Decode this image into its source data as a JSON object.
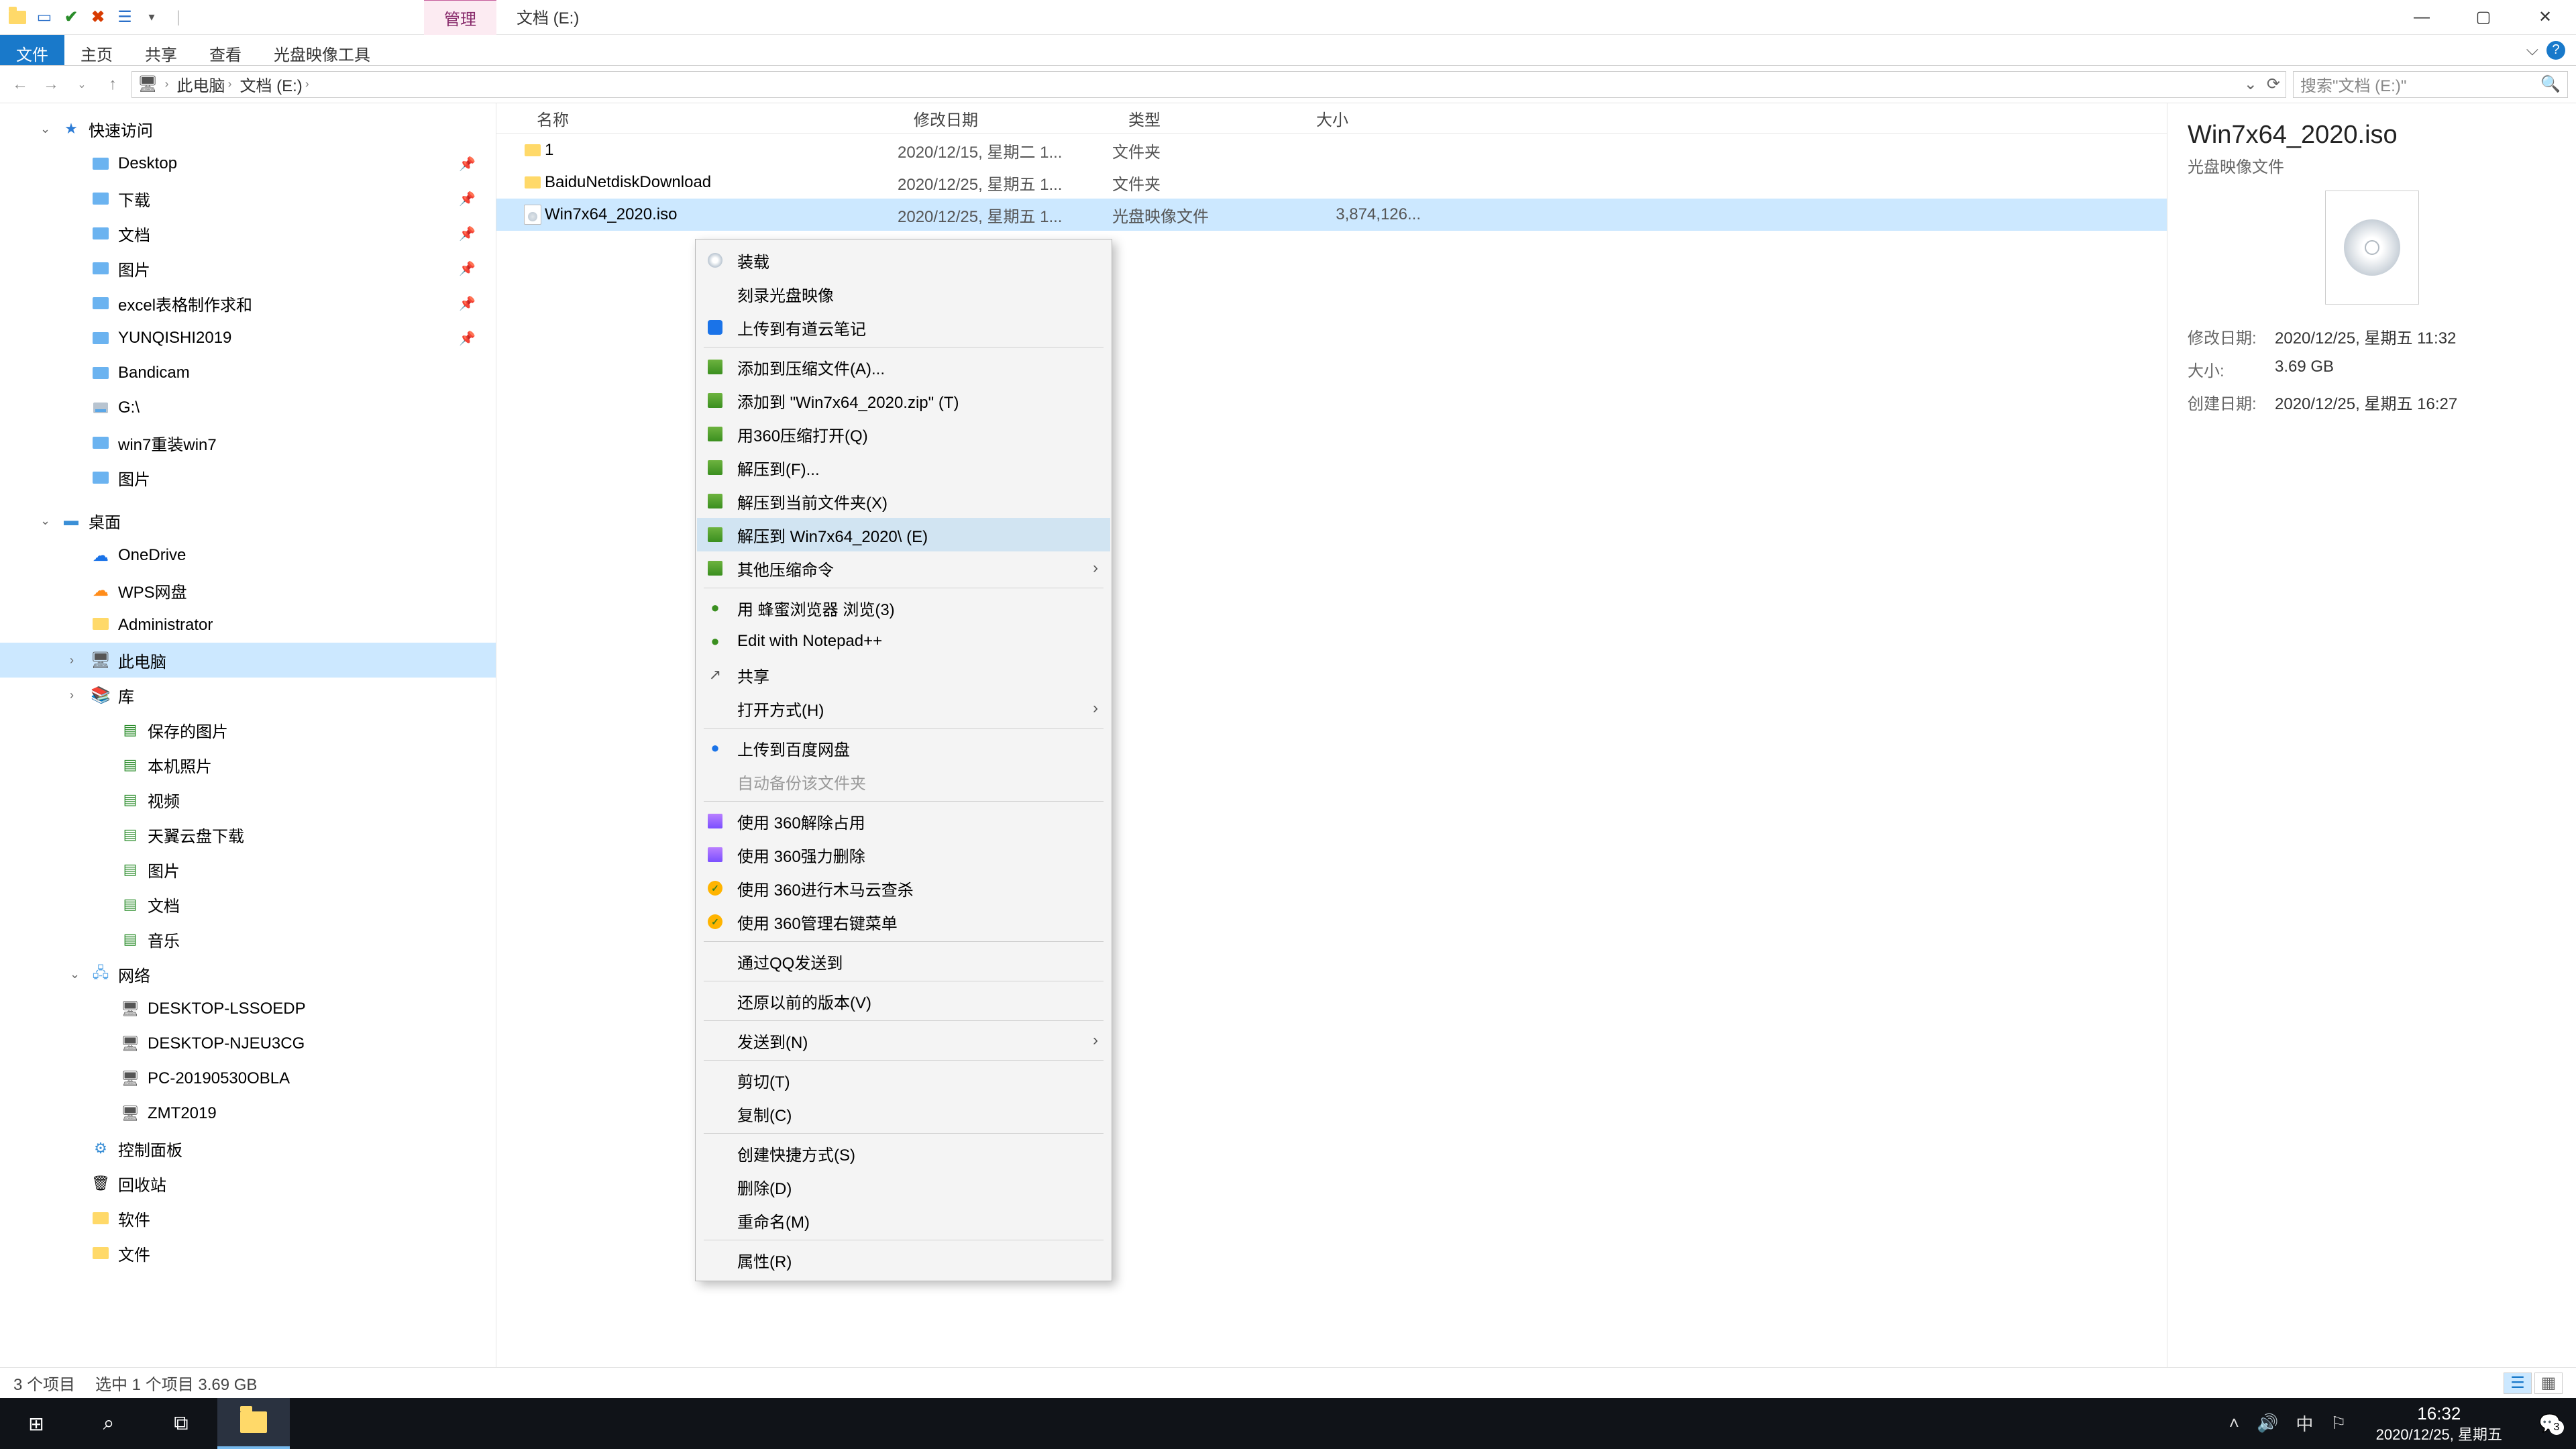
{
  "titlebar": {
    "manage_tab": "管理",
    "title": "文档 (E:)"
  },
  "ribbon": {
    "tabs": [
      "文件",
      "主页",
      "共享",
      "查看",
      "光盘映像工具"
    ]
  },
  "nav": {
    "back": "←",
    "forward": "→",
    "up": "↑",
    "segments": [
      "此电脑",
      "文档 (E:)"
    ],
    "search_placeholder": "搜索\"文档 (E:)\""
  },
  "tree": {
    "quick_access": "快速访问",
    "quick_items": [
      {
        "label": "Desktop",
        "pin": true
      },
      {
        "label": "下载",
        "pin": true
      },
      {
        "label": "文档",
        "pin": true
      },
      {
        "label": "图片",
        "pin": true
      },
      {
        "label": "excel表格制作求和",
        "pin": true
      },
      {
        "label": "YUNQISHI2019",
        "pin": true
      },
      {
        "label": "Bandicam",
        "pin": false
      },
      {
        "label": "G:\\",
        "pin": false,
        "disk": true
      },
      {
        "label": "win7重装win7",
        "pin": false
      },
      {
        "label": "图片",
        "pin": false
      }
    ],
    "desktop": "桌面",
    "desktop_items": [
      {
        "label": "OneDrive",
        "icon": "cloud-b"
      },
      {
        "label": "WPS网盘",
        "icon": "cloud-o"
      },
      {
        "label": "Administrator",
        "icon": "folder"
      },
      {
        "label": "此电脑",
        "icon": "pc",
        "selected": true
      },
      {
        "label": "库",
        "icon": "lib"
      }
    ],
    "lib_items": [
      "保存的图片",
      "本机照片",
      "视频",
      "天翼云盘下载",
      "图片",
      "文档",
      "音乐"
    ],
    "network": "网络",
    "net_items": [
      "DESKTOP-LSSOEDP",
      "DESKTOP-NJEU3CG",
      "PC-20190530OBLA",
      "ZMT2019"
    ],
    "control_panel": "控制面板",
    "recycle": "回收站",
    "software": "软件",
    "documents": "文件"
  },
  "columns": {
    "name": "名称",
    "date": "修改日期",
    "type": "类型",
    "size": "大小"
  },
  "files": [
    {
      "name": "1",
      "date": "2020/12/15, 星期二 1...",
      "type": "文件夹",
      "size": "",
      "folder": true
    },
    {
      "name": "BaiduNetdiskDownload",
      "date": "2020/12/25, 星期五 1...",
      "type": "文件夹",
      "size": "",
      "folder": true
    },
    {
      "name": "Win7x64_2020.iso",
      "date": "2020/12/25, 星期五 1...",
      "type": "光盘映像文件",
      "size": "3,874,126...",
      "folder": false,
      "selected": true
    }
  ],
  "context_menu": [
    {
      "label": "装载",
      "icon": "cd"
    },
    {
      "label": "刻录光盘映像"
    },
    {
      "label": "上传到有道云笔记",
      "icon": "blue"
    },
    {
      "sep": true
    },
    {
      "label": "添加到压缩文件(A)...",
      "icon": "arc"
    },
    {
      "label": "添加到 \"Win7x64_2020.zip\" (T)",
      "icon": "arc"
    },
    {
      "label": "用360压缩打开(Q)",
      "icon": "arc"
    },
    {
      "label": "解压到(F)...",
      "icon": "arc"
    },
    {
      "label": "解压到当前文件夹(X)",
      "icon": "arc"
    },
    {
      "label": "解压到 Win7x64_2020\\ (E)",
      "icon": "arc",
      "hover": true
    },
    {
      "label": "其他压缩命令",
      "icon": "arc",
      "sub": true
    },
    {
      "sep": true
    },
    {
      "label": "用 蜂蜜浏览器 浏览(3)",
      "icon": "dot-green"
    },
    {
      "label": "Edit with Notepad++",
      "icon": "dot-green"
    },
    {
      "label": "共享",
      "icon": "share"
    },
    {
      "label": "打开方式(H)",
      "sub": true
    },
    {
      "sep": true
    },
    {
      "label": "上传到百度网盘",
      "icon": "dot-blue"
    },
    {
      "label": "自动备份该文件夹",
      "disabled": true
    },
    {
      "sep": true
    },
    {
      "label": "使用 360解除占用",
      "icon": "purple"
    },
    {
      "label": "使用 360强力删除",
      "icon": "purple"
    },
    {
      "label": "使用 360进行木马云查杀",
      "icon": "360"
    },
    {
      "label": "使用 360管理右键菜单",
      "icon": "360"
    },
    {
      "sep": true
    },
    {
      "label": "通过QQ发送到"
    },
    {
      "sep": true
    },
    {
      "label": "还原以前的版本(V)"
    },
    {
      "sep": true
    },
    {
      "label": "发送到(N)",
      "sub": true
    },
    {
      "sep": true
    },
    {
      "label": "剪切(T)"
    },
    {
      "label": "复制(C)"
    },
    {
      "sep": true
    },
    {
      "label": "创建快捷方式(S)"
    },
    {
      "label": "删除(D)"
    },
    {
      "label": "重命名(M)"
    },
    {
      "sep": true
    },
    {
      "label": "属性(R)"
    }
  ],
  "details": {
    "title": "Win7x64_2020.iso",
    "subtitle": "光盘映像文件",
    "rows": [
      {
        "label": "修改日期:",
        "value": "2020/12/25, 星期五 11:32"
      },
      {
        "label": "大小:",
        "value": "3.69 GB"
      },
      {
        "label": "创建日期:",
        "value": "2020/12/25, 星期五 16:27"
      }
    ]
  },
  "status": {
    "count": "3 个项目",
    "selection": "选中 1 个项目  3.69 GB"
  },
  "taskbar": {
    "time": "16:32",
    "date": "2020/12/25, 星期五",
    "ime": "中",
    "notif_count": "3"
  }
}
